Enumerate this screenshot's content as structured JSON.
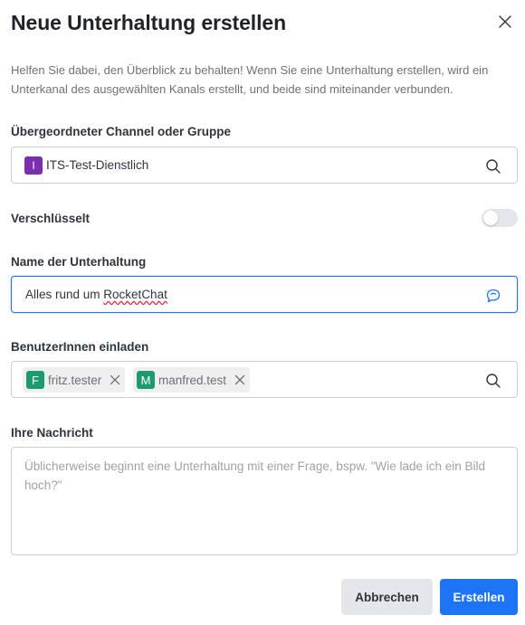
{
  "modal": {
    "title": "Neue Unterhaltung erstellen",
    "description": "Helfen Sie dabei, den Überblick zu behalten! Wenn Sie eine Unterhaltung erstellen, wird ein Unterkanal des ausgewählten Kanals erstellt, und beide sind miteinander verbunden."
  },
  "parent": {
    "label": "Übergeordneter Channel oder Gruppe",
    "avatar_letter": "I",
    "avatar_color": "#7b2fb0",
    "value": "ITS-Test-Dienstlich",
    "icon": "search-icon"
  },
  "encrypted": {
    "label": "Verschlüsselt",
    "enabled": false
  },
  "name": {
    "label": "Name der Unterhaltung",
    "value_prefix": "Alles rund um ",
    "value_misspelled": "RocketChat",
    "icon": "discussion-icon"
  },
  "invite": {
    "label": "BenutzerInnen einladen",
    "users": [
      {
        "initial": "F",
        "name": "fritz.tester",
        "color": "#1e9b6e"
      },
      {
        "initial": "M",
        "name": "manfred.test",
        "color": "#1e9b6e"
      }
    ],
    "icon": "search-icon"
  },
  "message": {
    "label": "Ihre Nachricht",
    "placeholder": "Üblicherweise beginnt eine Unterhaltung mit einer Frage, bspw. \"Wie lade ich ein Bild hoch?\""
  },
  "actions": {
    "cancel": "Abbrechen",
    "create": "Erstellen"
  },
  "colors": {
    "accent": "#1d74f5",
    "text": "#2f343d",
    "muted": "#6c727a"
  }
}
